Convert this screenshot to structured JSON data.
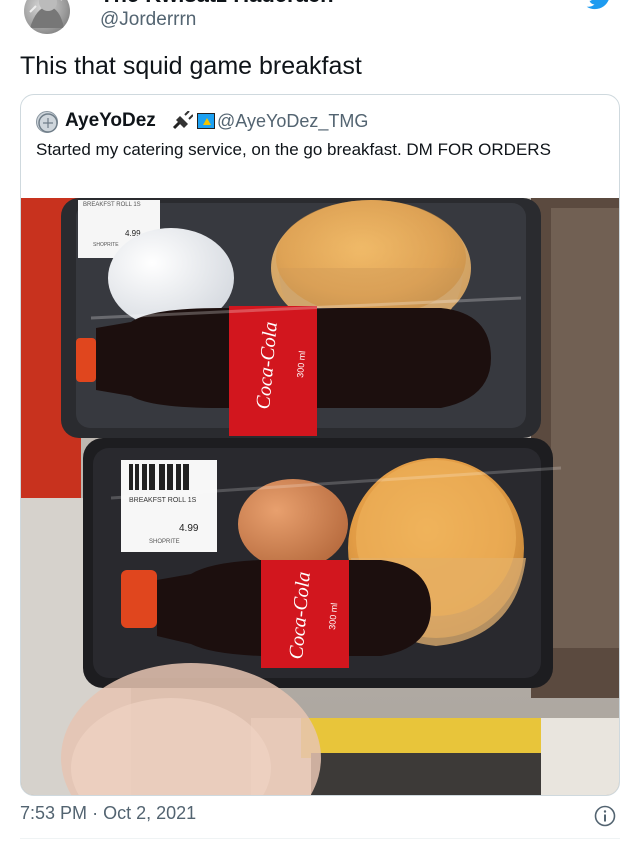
{
  "author": {
    "display_name": "The Kwisatz Haderach",
    "handle": "@Jorderrrn"
  },
  "tweet": {
    "text": "This that squid game breakfast",
    "time": "7:53 PM",
    "separator": "·",
    "date": "Oct 2, 2021"
  },
  "quoted": {
    "display_name": "AyeYoDez",
    "handle": "@AyeYoDez_TMG",
    "text": "Started my catering service, on the go breakfast. DM FOR ORDERS"
  },
  "photo": {
    "top_label": {
      "line1": "BREAKFST ROLL 1S",
      "price": "4.99",
      "store": "SHOPRITE"
    },
    "bottom_label": {
      "line1": "BREAKFST ROLL 1S",
      "price": "4.99",
      "store": "SHOPRITE"
    },
    "coke_brand": "Coca-Cola",
    "coke_volume": "300 ml"
  },
  "colors": {
    "twitter_blue": "#1d9bf0",
    "coke_red": "#d2161e",
    "text_secondary": "#536471"
  }
}
